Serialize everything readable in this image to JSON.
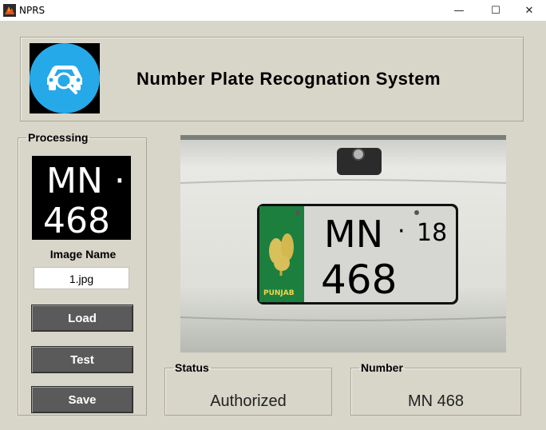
{
  "window": {
    "title": "NPRS",
    "minimize": "—",
    "maximize": "☐",
    "close": "✕"
  },
  "header": {
    "title": "Number Plate Recognation System",
    "logo_icon": "car-search-icon"
  },
  "processing": {
    "legend": "Processing",
    "preview_text_top": "MN ·",
    "preview_text_bottom": "468",
    "image_name_label": "Image Name",
    "image_name_value": "1.jpg",
    "buttons": {
      "load": "Load",
      "test": "Test",
      "save": "Save"
    }
  },
  "photo": {
    "plate_line1": "MN",
    "plate_dot": "·",
    "plate_small": "18",
    "plate_line2": "468",
    "plate_province": "PUNJAB"
  },
  "status": {
    "legend": "Status",
    "value": "Authorized"
  },
  "number": {
    "legend": "Number",
    "value": "MN 468"
  },
  "colors": {
    "background": "#d8d5c9",
    "button": "#5a5a5a",
    "logo_circle": "#26a9e8",
    "plate_green": "#1d7f3e"
  }
}
